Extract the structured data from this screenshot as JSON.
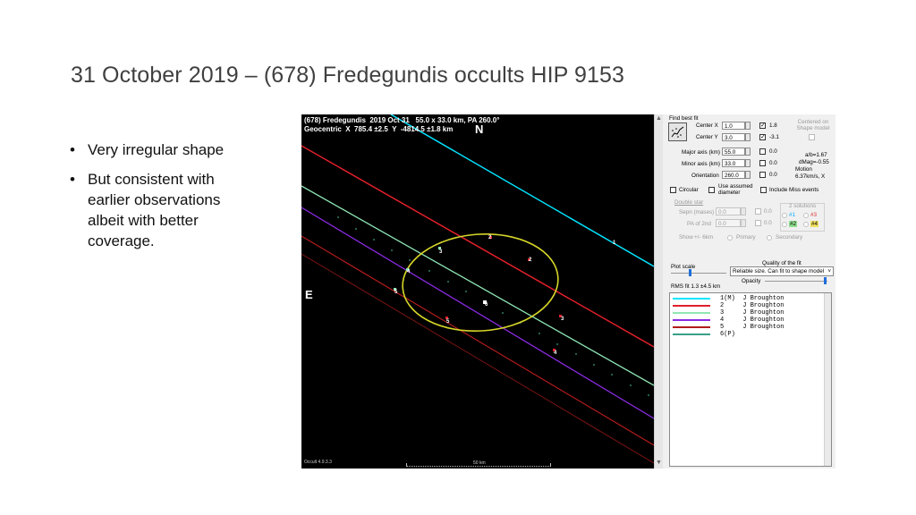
{
  "slide": {
    "title": "31 October 2019 – (678) Fredegundis occults HIP 9153",
    "bullets": [
      "Very irregular shape",
      "But consistent with earlier observations albeit with better coverage."
    ],
    "bullet_glyph": "•"
  },
  "plot": {
    "header_line1": "(678) Fredegundis  2019 Oct 31   55.0 x 33.0 km, PA 260.0°",
    "header_line2": "Geocentric  X  785.4 ±2.5  Y  -4814.5 ±1.8 km",
    "north_label": "N",
    "east_label": "E",
    "footer_left": "Occult 4.9.3.3",
    "scale_label": "50 km",
    "chord_labels": [
      "1",
      "2",
      "3",
      "4",
      "5",
      "6"
    ]
  },
  "panel": {
    "find_best_fit": "Find best fit",
    "center_x_label": "Center X",
    "center_x_value": "1.0",
    "center_x_result": "1.8",
    "center_y_label": "Center Y",
    "center_y_value": "3.0",
    "center_y_result": "-3.1",
    "centered_on_shape": "Centered on Shape model",
    "major_axis_label": "Major axis (km)",
    "major_axis_value": "55.0",
    "major_axis_result": "0.0",
    "minor_axis_label": "Minor axis (km)",
    "minor_axis_value": "33.0",
    "minor_axis_result": "0.0",
    "orientation_label": "Orientation",
    "orientation_value": "260.0",
    "orientation_result": "0.0",
    "ab_ratio": "a/b=1.67",
    "dmag": "dMag=-0.55",
    "motion_label": "Motion",
    "motion_value": "6.37km/s, X",
    "circular_label": "Circular",
    "use_assumed_diameter": "Use assumed diameter",
    "include_miss_events": "Include Miss events",
    "double_star": "Double star",
    "sepn_label": "Sepn (mases)",
    "sepn_value": "0.0",
    "sepn_result": "0.0",
    "pa_2nd_label": "PA of 2nd",
    "pa_2nd_value": "0.0",
    "pa_2nd_result": "0.0",
    "solutions_label": "2 solutions",
    "sol1": "#1",
    "sol2": "#2",
    "sol3": "#3",
    "sol4": "#4",
    "show_label": "Show",
    "show_plus_minus": "+/- 6km",
    "primary_label": "Primary",
    "secondary_label": "Secondary",
    "plot_scale_label": "Plot scale",
    "quality_label": "Quality of the fit",
    "quality_value": "Reliable size. Can fit to shape model",
    "opacity_label": "Opacity",
    "rms_label": "RMS fit 1.3 ±4.5 km",
    "observers": [
      {
        "label": "1(M)  J Broughton",
        "color": "#00e5ff"
      },
      {
        "label": "2     J Broughton",
        "color": "#e0202a"
      },
      {
        "label": "3     J Broughton",
        "color": "#8ee6b4"
      },
      {
        "label": "4     J Broughton",
        "color": "#8a2be2"
      },
      {
        "label": "5     J Broughton",
        "color": "#b01c1c"
      },
      {
        "label": "6(P)",
        "color": "#3aa08a"
      }
    ]
  },
  "colors": {
    "chord1": "#00e5ff",
    "chord2": "#e0202a",
    "chord3": "#8ee6b4",
    "chord4": "#8a2be2",
    "chord5": "#b01c1c",
    "chord6": "#3aa08a",
    "ellipse": "#d6d62a",
    "background": "#000000"
  }
}
